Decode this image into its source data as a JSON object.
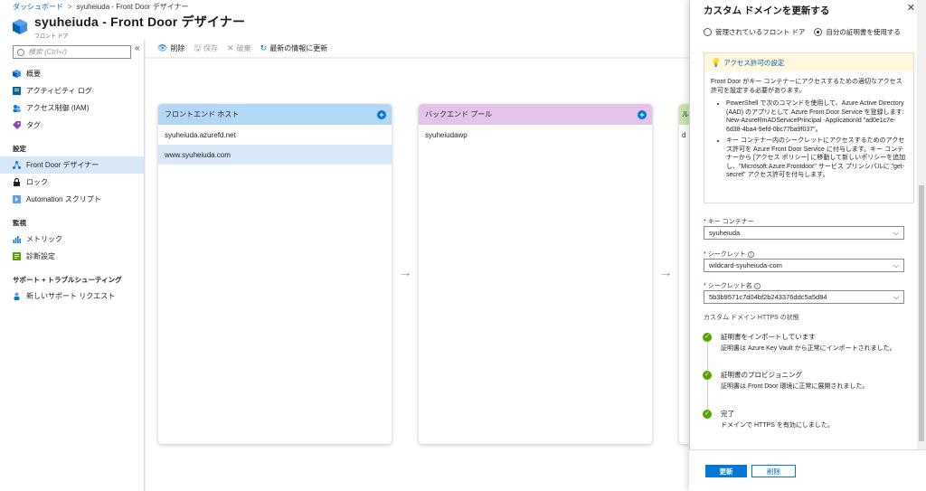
{
  "breadcrumb": {
    "home": "ダッシュボード",
    "sep": ">",
    "current": "syuheiuda - Front Door デザイナー"
  },
  "header": {
    "title": "syuheiuda - Front Door デザイナー",
    "subtitle": "フロント ドア"
  },
  "sidebar": {
    "search_placeholder": "検索 (Ctrl+/)",
    "collapse": "«",
    "items": [
      {
        "label": "概要"
      },
      {
        "label": "アクティビティ ログ"
      },
      {
        "label": "アクセス制御 (IAM)"
      },
      {
        "label": "タグ"
      }
    ],
    "section_settings": "設定",
    "settings_items": [
      {
        "label": "Front Door デザイナー"
      },
      {
        "label": "ロック"
      },
      {
        "label": "Automation スクリプト"
      }
    ],
    "section_monitoring": "監視",
    "monitoring_items": [
      {
        "label": "メトリック"
      },
      {
        "label": "診断設定"
      }
    ],
    "section_support": "サポート + トラブルシューティング",
    "support_items": [
      {
        "label": "新しいサポート リクエスト"
      }
    ]
  },
  "toolbar": {
    "delete": "削除",
    "save": "保存",
    "discard": "破棄",
    "refresh": "最新の情報に更新"
  },
  "designer": {
    "frontend": {
      "title": "フロントエンド ホスト",
      "hosts": [
        "syuheiuda.azurefd.net",
        "www.syuheiuda.com"
      ]
    },
    "backend": {
      "title": "バックエンド プール",
      "pools": [
        "syuheiudawp"
      ]
    },
    "routing": {
      "title": "ル",
      "rows": [
        "d"
      ]
    },
    "add_symbol": "+",
    "arrow": "→"
  },
  "panel": {
    "title": "カスタム ドメインを更新する",
    "close": "✕",
    "radio_managed": "管理されているフロント ドア",
    "radio_own": "自分の証明書を使用する",
    "info_title": "アクセス許可の設定",
    "info_intro": "Front Door がキー コンテナーにアクセスするための適切なアクセス許可を設定する必要があります。",
    "info_step1": "PowerShell で次のコマンドを使用して、Azure Active Directory (AAD) のアプリとして Azure Front Door Service を登録します: New-AzureRmADServicePrincipal -ApplicationId \"ad0e1c7e-6d38-4ba4-9efd-0bc77ba9f037\"。",
    "info_step2": "キー コンテナー内のシークレットにアクセスするためのアクセス許可を Azure Front Door Service に付与します。キー コンテナーから [アクセス ポリシー] に移動して新しいポリシーを追加し、\"Microsoft.Azure.Frontdoor\" サービス プリンシパルに \"get-secret\" アクセス許可を付与します。",
    "key_vault_label": "キー コンテナー",
    "key_vault_value": "syuheiuda",
    "secret_label": "シークレット",
    "secret_value": "wildcard-syuheiuda-com",
    "secret_version_label": "シークレット名",
    "secret_version_value": "5b3b9571c7d04bf2b243376ddc5a5d84",
    "status_title": "カスタム ドメイン HTTPS の状態",
    "steps": [
      {
        "title": "証明書をインポートしています",
        "detail": "証明書は Azure Key Vault から正常にインポートされました。"
      },
      {
        "title": "証明書のプロビジョニング",
        "detail": "証明書は Front Door 環境に正常に展開されました。"
      },
      {
        "title": "完了",
        "detail": "ドメインで HTTPS を有効にしました。"
      }
    ],
    "update_button": "更新",
    "delete_button": "削除"
  },
  "colors": {
    "accent": "#0078d4",
    "frontend_header": "#b3d7f7",
    "backend_header": "#e3c3ea",
    "routing_header": "#c9e5ad",
    "success": "#57a300"
  }
}
